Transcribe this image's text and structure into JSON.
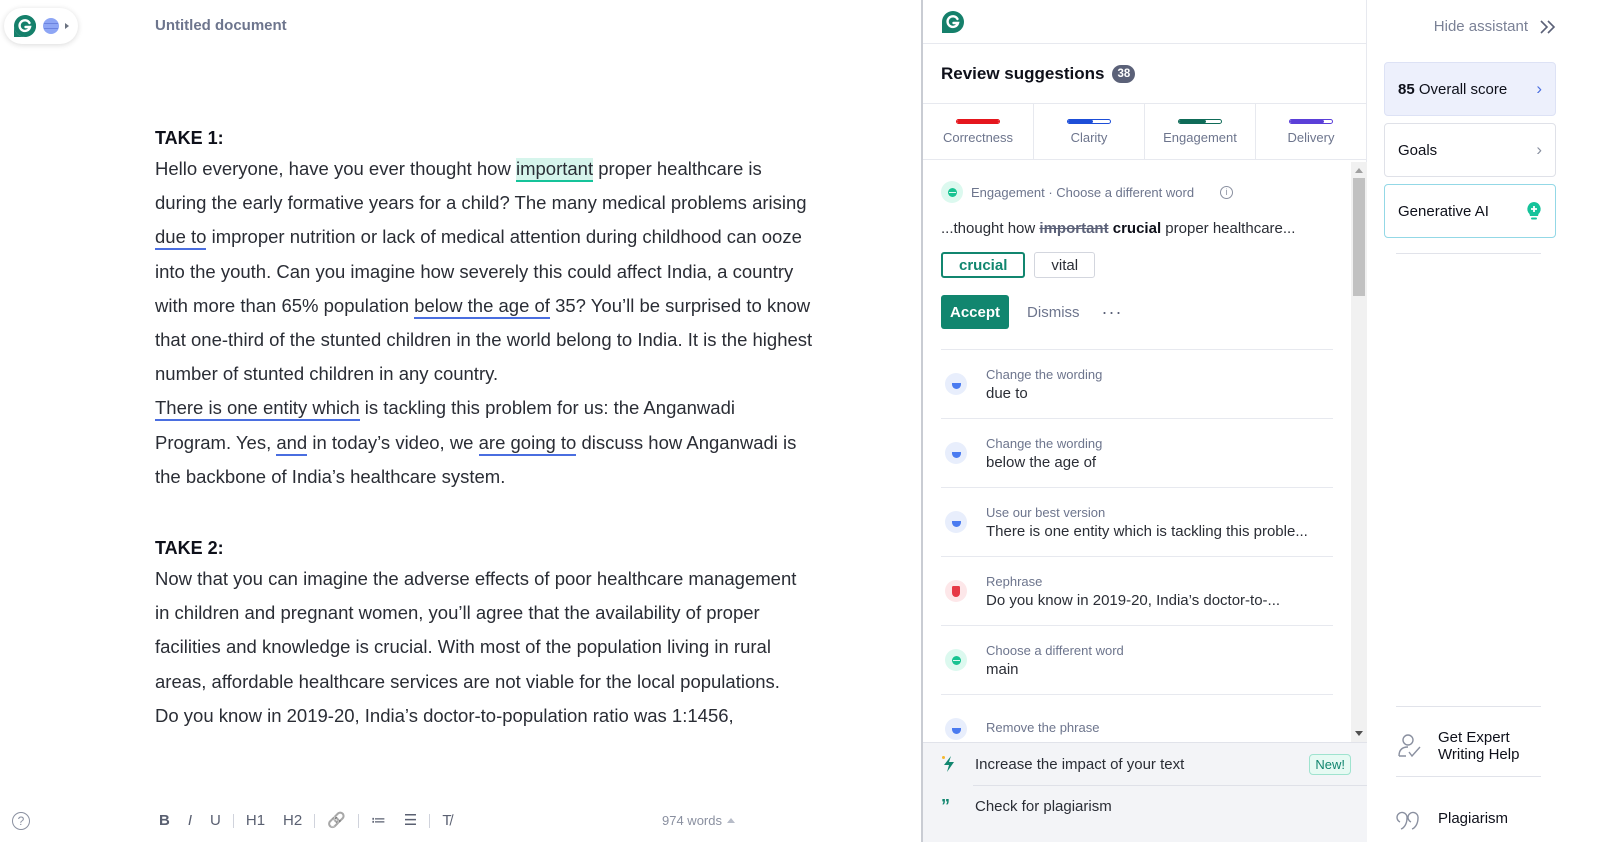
{
  "editor": {
    "document_title": "Untitled document",
    "sections": [
      {
        "heading": "TAKE 1:",
        "paragraphs": [
          {
            "segments": [
              {
                "text": "Hello everyone, have you ever thought how "
              },
              {
                "text": "important",
                "mark": "green"
              },
              {
                "text": " proper healthcare is during the early formative years for a child? The many medical problems arising "
              },
              {
                "text": "due to",
                "mark": "blue"
              },
              {
                "text": " improper nutrition or lack of medical attention during childhood can ooze into the youth. Can you imagine how severely this could affect India, a country with more than 65% population "
              },
              {
                "text": "below the age of",
                "mark": "blue"
              },
              {
                "text": " 35? You’ll be surprised to know that one-third of the stunted children in the world belong to India. It is the highest number of stunted children in any country."
              }
            ]
          },
          {
            "segments": [
              {
                "text": "There is one entity which",
                "mark": "blue"
              },
              {
                "text": " is tackling this problem for us: the Anganwadi Program. Yes, "
              },
              {
                "text": "and",
                "mark": "blue"
              },
              {
                "text": " in today’s video, we "
              },
              {
                "text": "are going to",
                "mark": "blue"
              },
              {
                "text": " discuss how Anganwadi is the backbone of India’s healthcare system."
              }
            ]
          }
        ]
      },
      {
        "heading": "TAKE 2:",
        "paragraphs": [
          {
            "segments": [
              {
                "text": "Now that you can imagine the adverse effects of poor healthcare management in children and pregnant women, you’ll agree that the availability of proper facilities and knowledge is crucial. With most of the population living in rural areas, affordable healthcare services are not viable for the local populations."
              }
            ]
          },
          {
            "segments": [
              {
                "text": "Do you know in 2019-20, India’s doctor-to-population ratio was 1:1456,"
              }
            ]
          }
        ]
      }
    ],
    "toolbar": {
      "help_label": "?",
      "buttons": [
        {
          "name": "bold",
          "label": "B"
        },
        {
          "name": "italic",
          "label": "I"
        },
        {
          "name": "underline",
          "label": "U"
        },
        {
          "sep": true
        },
        {
          "name": "heading1",
          "label": "H1"
        },
        {
          "name": "heading2",
          "label": "H2"
        },
        {
          "sep": true
        },
        {
          "name": "link",
          "label": "🔗"
        },
        {
          "sep": true
        },
        {
          "name": "numbered-list",
          "label": "≔"
        },
        {
          "name": "bulleted-list",
          "label": "☰"
        },
        {
          "sep": true
        },
        {
          "name": "clear-format",
          "label": "T̸"
        }
      ],
      "word_count": "974 words"
    }
  },
  "assistant": {
    "title": "Review suggestions",
    "count": "38",
    "categories": [
      {
        "label": "Correctness",
        "color": "#e5161d",
        "progress": 1.0
      },
      {
        "label": "Clarity",
        "color": "#1d4ed8",
        "progress": 0.6
      },
      {
        "label": "Engagement",
        "color": "#0f6b58",
        "progress": 0.65
      },
      {
        "label": "Delivery",
        "color": "#5b3fd8",
        "progress": 0.8
      }
    ],
    "active": {
      "meta": "Engagement · Choose a different word",
      "preview_before": "...thought how ",
      "preview_strike": "important",
      "preview_replacement": "crucial",
      "preview_after": " proper healthcare...",
      "options": [
        "crucial",
        "vital"
      ],
      "accept_label": "Accept",
      "dismiss_label": "Dismiss",
      "more_label": "···"
    },
    "suggestions": [
      {
        "type": "Change the wording",
        "value": "due to",
        "category": "clarity"
      },
      {
        "type": "Change the wording",
        "value": "below the age of",
        "category": "clarity"
      },
      {
        "type": "Use our best version",
        "value": "There is one entity which is tackling this proble...",
        "category": "clarity"
      },
      {
        "type": "Rephrase",
        "value": "Do you know in 2019-20, India’s doctor-to-...",
        "category": "correctness"
      },
      {
        "type": "Choose a different word",
        "value": "main",
        "category": "engagement"
      },
      {
        "type": "Remove the phrase",
        "value": "",
        "category": "clarity"
      }
    ],
    "footer": [
      {
        "label": "Increase the impact of your text",
        "badge": "New!"
      },
      {
        "label": "Check for plagiarism"
      }
    ]
  },
  "rail": {
    "hide_label": "Hide assistant",
    "score_value": "85",
    "score_label": "Overall score",
    "goals_label": "Goals",
    "genai_label": "Generative AI",
    "expert_label": "Get Expert Writing Help",
    "plagiarism_label": "Plagiarism"
  },
  "colors": {
    "brand": "#11866f",
    "clarity_underline": "#4a6ee0",
    "engagement_underline": "#15c39a"
  }
}
